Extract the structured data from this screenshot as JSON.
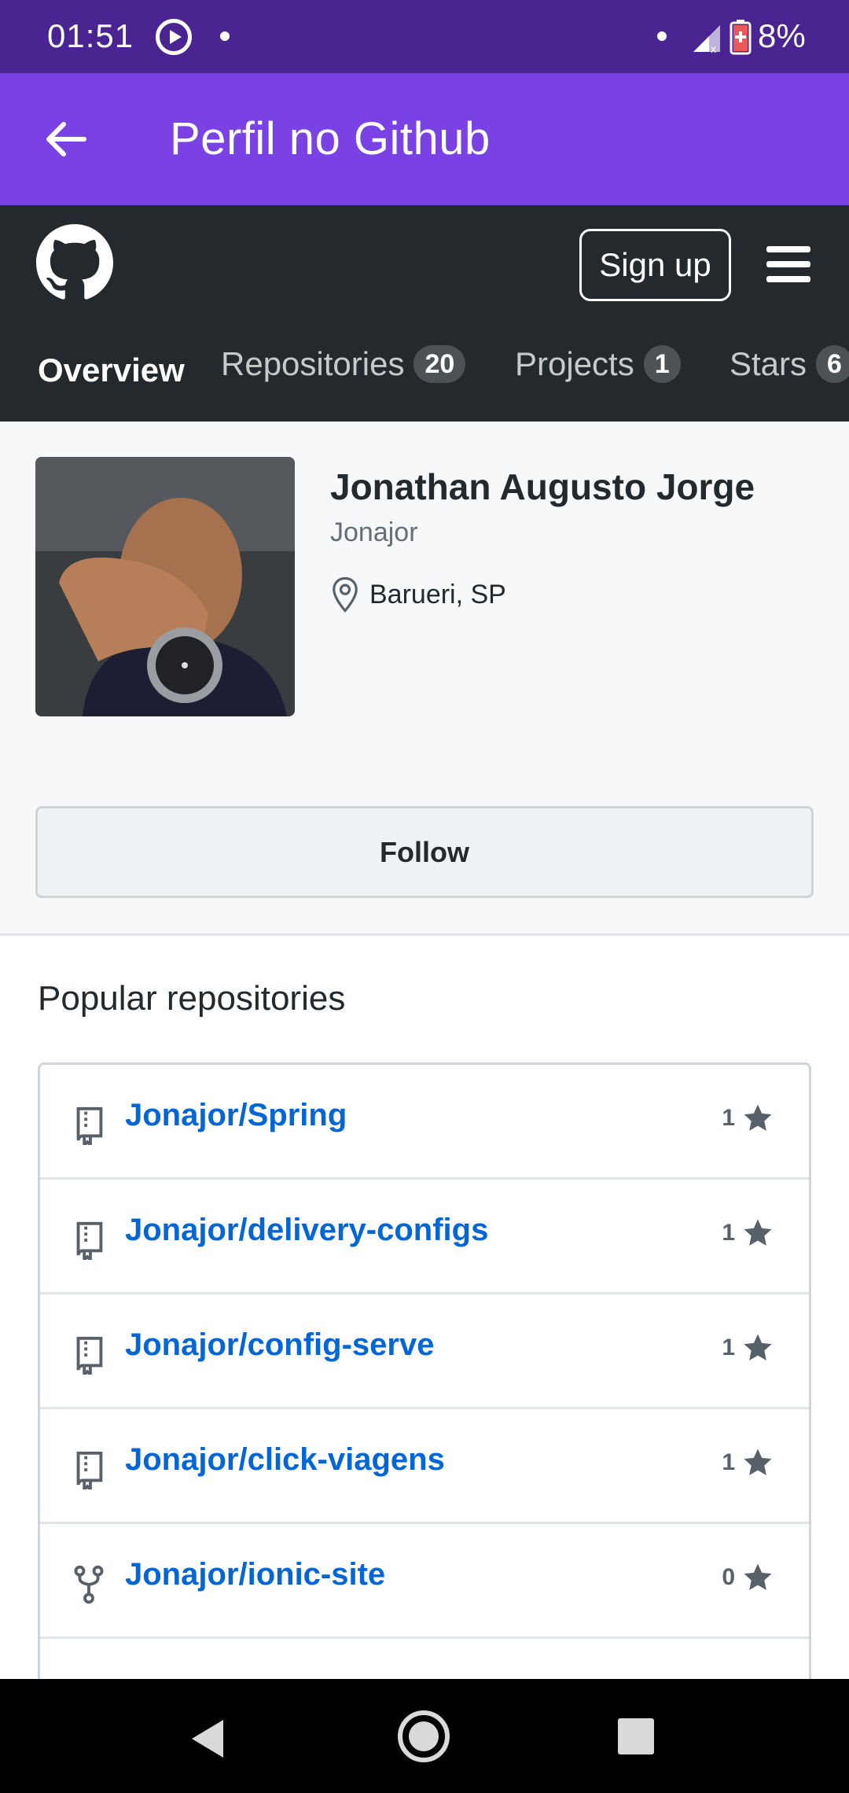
{
  "status_bar": {
    "time": "01:51",
    "battery": "8%"
  },
  "app_bar": {
    "title": "Perfil no Github"
  },
  "github_header": {
    "signup_label": "Sign up",
    "tabs": [
      {
        "label": "Overview",
        "count": ""
      },
      {
        "label": "Repositories",
        "count": "20"
      },
      {
        "label": "Projects",
        "count": "1"
      },
      {
        "label": "Stars",
        "count": "6"
      }
    ]
  },
  "profile": {
    "full_name": "Jonathan Augusto Jorge",
    "username": "Jonajor",
    "location": "Barueri, SP",
    "follow_label": "Follow"
  },
  "popular": {
    "title": "Popular repositories",
    "repos": [
      {
        "name": "Jonajor/Spring",
        "stars": "1",
        "icon": "repo-icon"
      },
      {
        "name": "Jonajor/delivery-configs",
        "stars": "1",
        "icon": "repo-icon"
      },
      {
        "name": "Jonajor/config-serve",
        "stars": "1",
        "icon": "repo-icon"
      },
      {
        "name": "Jonajor/click-viagens",
        "stars": "1",
        "icon": "repo-icon"
      },
      {
        "name": "Jonajor/ionic-site",
        "stars": "0",
        "icon": "fork-icon"
      }
    ]
  },
  "colors": {
    "status_bar": "#4a2591",
    "app_bar": "#7a42e4",
    "github_header": "#24292e",
    "link": "#0366d6"
  }
}
